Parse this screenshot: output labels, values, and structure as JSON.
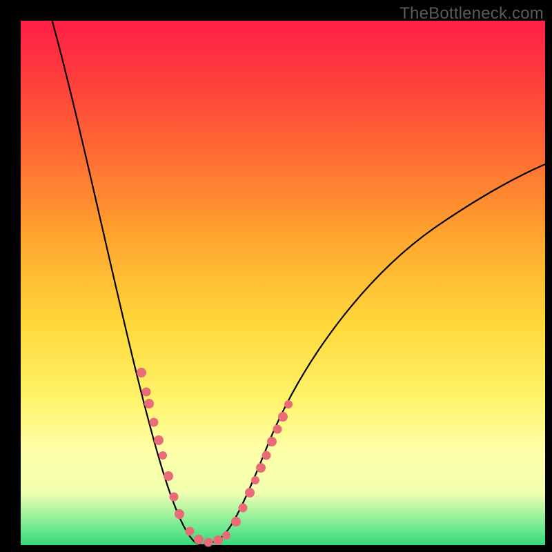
{
  "watermark": "TheBottleneck.com",
  "chart_data": {
    "type": "line",
    "title": "",
    "xlabel": "",
    "ylabel": "",
    "xlim": [
      0,
      100
    ],
    "ylim": [
      0,
      100
    ],
    "series": [
      {
        "name": "bottleneck-curve",
        "x": [
          5,
          8,
          12,
          16,
          20,
          24,
          26,
          28,
          30,
          32,
          34,
          36,
          38,
          40,
          45,
          50,
          55,
          60,
          65,
          70,
          75,
          80,
          85,
          90,
          95,
          100
        ],
        "y": [
          100,
          90,
          78,
          64,
          48,
          32,
          24,
          16,
          8,
          3,
          0,
          0,
          2,
          6,
          16,
          26,
          34,
          41,
          47,
          52,
          57,
          61,
          64,
          67,
          69,
          71
        ]
      }
    ],
    "markers": {
      "name": "highlight-points",
      "color": "#e96b77",
      "x": [
        22.5,
        23,
        24.5,
        25.5,
        26,
        27,
        28,
        29,
        31,
        32,
        33,
        34,
        35,
        35.5,
        37,
        38.5,
        40,
        41,
        42,
        43,
        44,
        45,
        46,
        47,
        48
      ],
      "y": [
        38,
        36,
        30,
        26,
        24,
        20,
        16,
        11,
        5,
        3,
        1,
        0,
        0,
        0.5,
        2,
        5,
        8,
        10,
        12,
        14,
        16,
        18,
        20,
        22,
        24
      ]
    },
    "gradient_stops": [
      {
        "pos": 0.0,
        "color": "#ff1f47"
      },
      {
        "pos": 0.25,
        "color": "#ff6a33"
      },
      {
        "pos": 0.58,
        "color": "#ffd83a"
      },
      {
        "pos": 0.82,
        "color": "#ffffa8"
      },
      {
        "pos": 1.0,
        "color": "#34d97a"
      }
    ]
  }
}
